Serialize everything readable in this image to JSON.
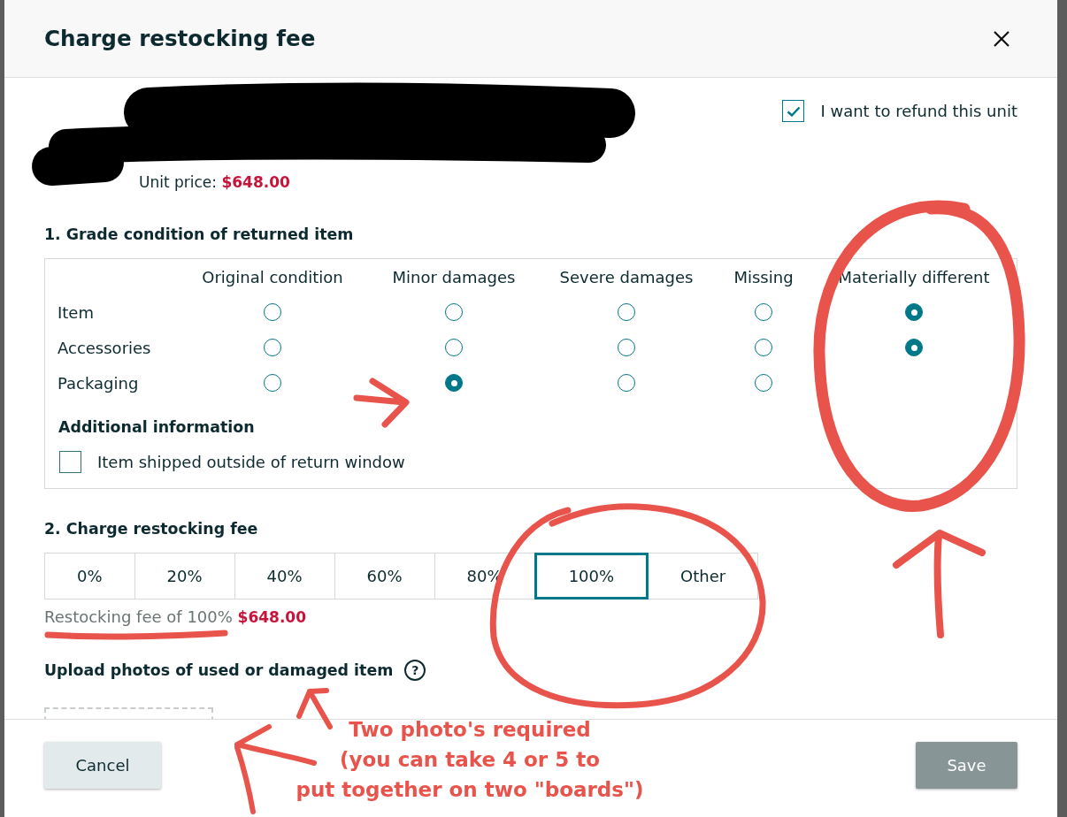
{
  "dialog": {
    "title": "Charge restocking fee"
  },
  "product": {
    "unit_price": "Unit price: **$648.00**",
    "refund": {
      "label": "I want to refund this unit",
      "checked": true
    }
  },
  "grading": {
    "title": "1. Grade condition of returned item",
    "columns": [
      "Original condition",
      "Minor damages",
      "Severe damages",
      "Missing",
      "Materially different"
    ],
    "rows": [
      {
        "label": "Item",
        "options": [
          {
            "selected": false
          },
          {
            "selected": false
          },
          {
            "selected": false
          },
          {
            "selected": false
          },
          {
            "selected": true
          }
        ]
      },
      {
        "label": "Accessories",
        "options": [
          {
            "selected": false
          },
          {
            "selected": false
          },
          {
            "selected": false
          },
          {
            "selected": false
          },
          {
            "selected": true
          }
        ]
      },
      {
        "label": "Packaging",
        "options": [
          {
            "selected": false
          },
          {
            "selected": true
          },
          {
            "selected": false
          },
          {
            "selected": false
          }
        ]
      }
    ],
    "additional": {
      "title": "Additional information",
      "checkbox": {
        "label": "Item shipped outside of return window",
        "checked": false
      }
    }
  },
  "restocking": {
    "title": "2. Charge restocking fee",
    "options": [
      {
        "label": "0%",
        "selected": false
      },
      {
        "label": "20%",
        "selected": false
      },
      {
        "label": "40%",
        "selected": false
      },
      {
        "label": "60%",
        "selected": false
      },
      {
        "label": "80%",
        "selected": false
      },
      {
        "label": "100%",
        "selected": true
      },
      {
        "label": "Other",
        "selected": false
      }
    ],
    "summary": "Restocking fee of 100% **$648.00**"
  },
  "upload": {
    "title": "Upload photos of used or damaged item",
    "help": "?"
  },
  "footer": {
    "buttons": [
      {
        "label": "Cancel",
        "kind": "secondary",
        "disabled": false
      },
      {
        "label": "Save",
        "kind": "primary",
        "disabled": true
      }
    ]
  },
  "annotation": {
    "note_lines": [
      "Two photo's required",
      "(you can take 4 or 5 to",
      "put together on two \"boards\")"
    ]
  }
}
